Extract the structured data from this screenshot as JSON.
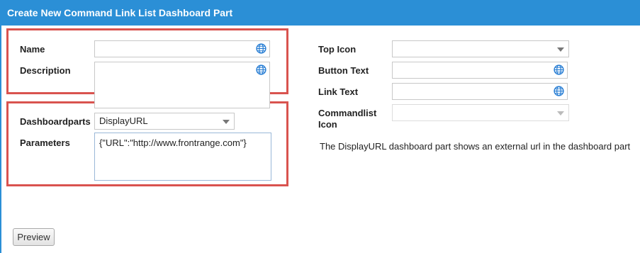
{
  "dialog": {
    "title": "Create New Command Link List Dashboard Part"
  },
  "form": {
    "name_label": "Name",
    "name_value": "",
    "description_label": "Description",
    "description_value": "",
    "dashboardparts_label": "Dashboardparts",
    "dashboardparts_value": "DisplayURL",
    "parameters_label": "Parameters",
    "parameters_value": "{\"URL\":\"http://www.frontrange.com\"}",
    "top_icon_label": "Top Icon",
    "top_icon_value": "",
    "button_text_label": "Button Text",
    "button_text_value": "",
    "link_text_label": "Link Text",
    "link_text_value": "",
    "commandlist_icon_label_line1": "Commandlist",
    "commandlist_icon_label_line2": "Icon",
    "commandlist_icon_value": "",
    "info_text": "The DisplayURL dashboard part shows an external url in the dashboard part"
  },
  "buttons": {
    "preview": "Preview"
  },
  "icons": {
    "globe": "globe-icon",
    "dropdown": "chevron-down-icon"
  },
  "colors": {
    "title_bar": "#2b8fd6",
    "highlight_border": "#d9534f",
    "globe_icon": "#2a7fd4"
  }
}
